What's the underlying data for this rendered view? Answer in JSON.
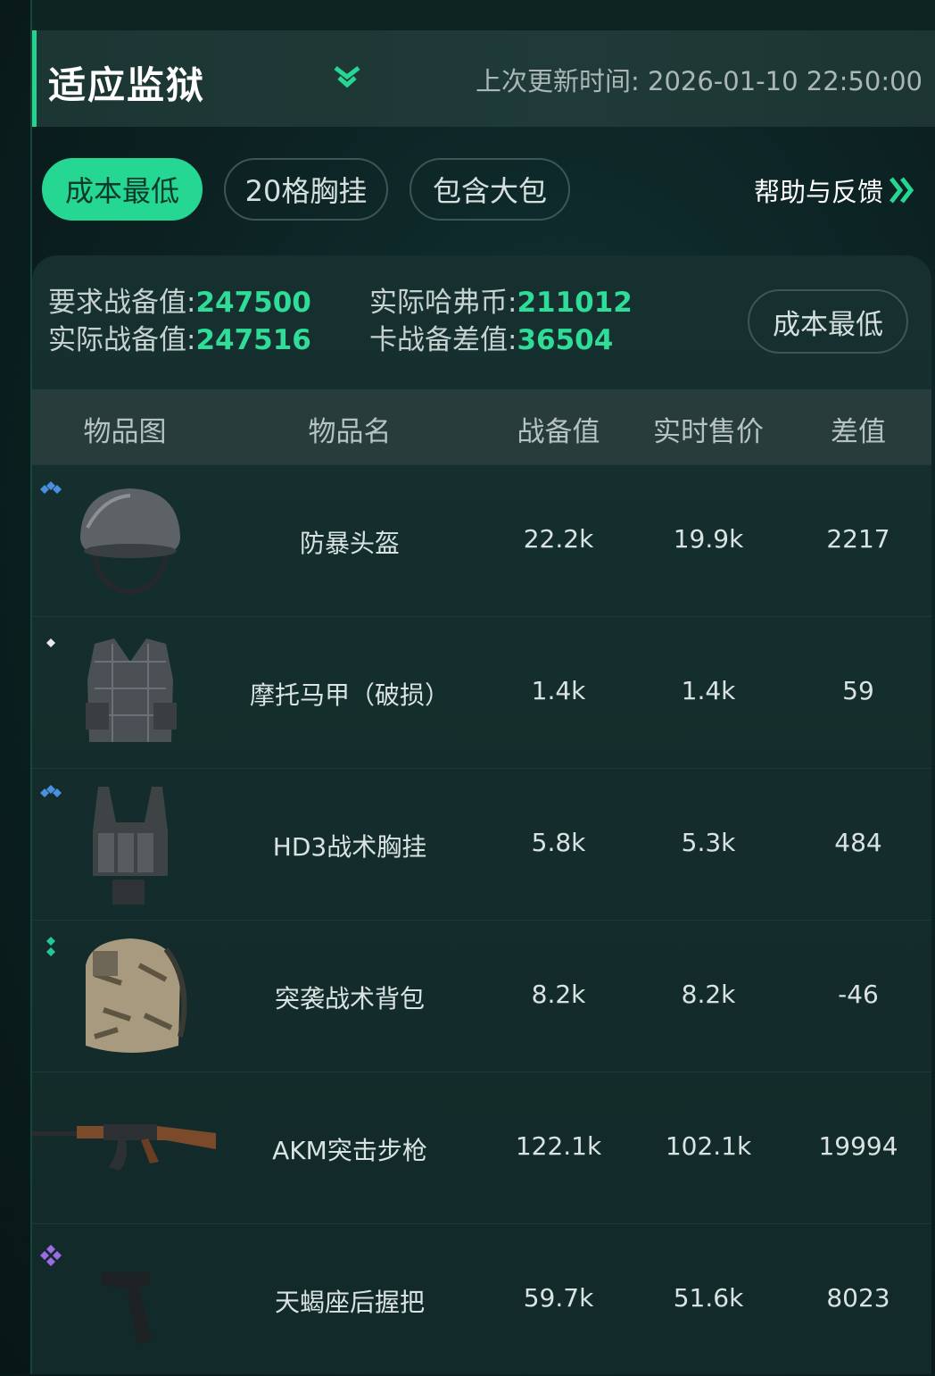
{
  "header": {
    "title": "适应监狱",
    "updated_label": "上次更新时间: 2026-01-10 22:50:00"
  },
  "tabs": [
    {
      "label": "成本最低",
      "active": true
    },
    {
      "label": "20格胸挂",
      "active": false
    },
    {
      "label": "包含大包",
      "active": false
    }
  ],
  "help_label": "帮助与反馈",
  "summary": {
    "req_label": "要求战备值:",
    "req_value": "247500",
    "actual_label": "实际战备值:",
    "actual_value": "247516",
    "coin_label": "实际哈弗币:",
    "coin_value": "211012",
    "diff_label": "卡战备差值:",
    "diff_value": "36504",
    "mode_label": "成本最低"
  },
  "columns": [
    "物品图",
    "物品名",
    "战备值",
    "实时售价",
    "差值"
  ],
  "items": [
    {
      "name": "防暴头盔",
      "value": "22.2k",
      "price": "19.9k",
      "diff": "2217",
      "rarity": "blue",
      "icon": "helmet-icon"
    },
    {
      "name": "摩托马甲（破损）",
      "value": "1.4k",
      "price": "1.4k",
      "diff": "59",
      "rarity": "white",
      "icon": "vest-icon"
    },
    {
      "name": "HD3战术胸挂",
      "value": "5.8k",
      "price": "5.3k",
      "diff": "484",
      "rarity": "blue",
      "icon": "chest-rig-icon"
    },
    {
      "name": "突袭战术背包",
      "value": "8.2k",
      "price": "8.2k",
      "diff": "-46",
      "rarity": "green",
      "icon": "backpack-icon"
    },
    {
      "name": "AKM突击步枪",
      "value": "122.1k",
      "price": "102.1k",
      "diff": "19994",
      "rarity": "none",
      "icon": "rifle-icon"
    },
    {
      "name": "天蝎座后握把",
      "value": "59.7k",
      "price": "51.6k",
      "diff": "8023",
      "rarity": "purple",
      "icon": "grip-icon"
    }
  ],
  "colors": {
    "accent": "#26d794",
    "value_green": "#2fdc98",
    "blue": "#4a8fe0",
    "green": "#25c69a",
    "purple": "#9b6be6",
    "white": "#e8e8e8"
  }
}
